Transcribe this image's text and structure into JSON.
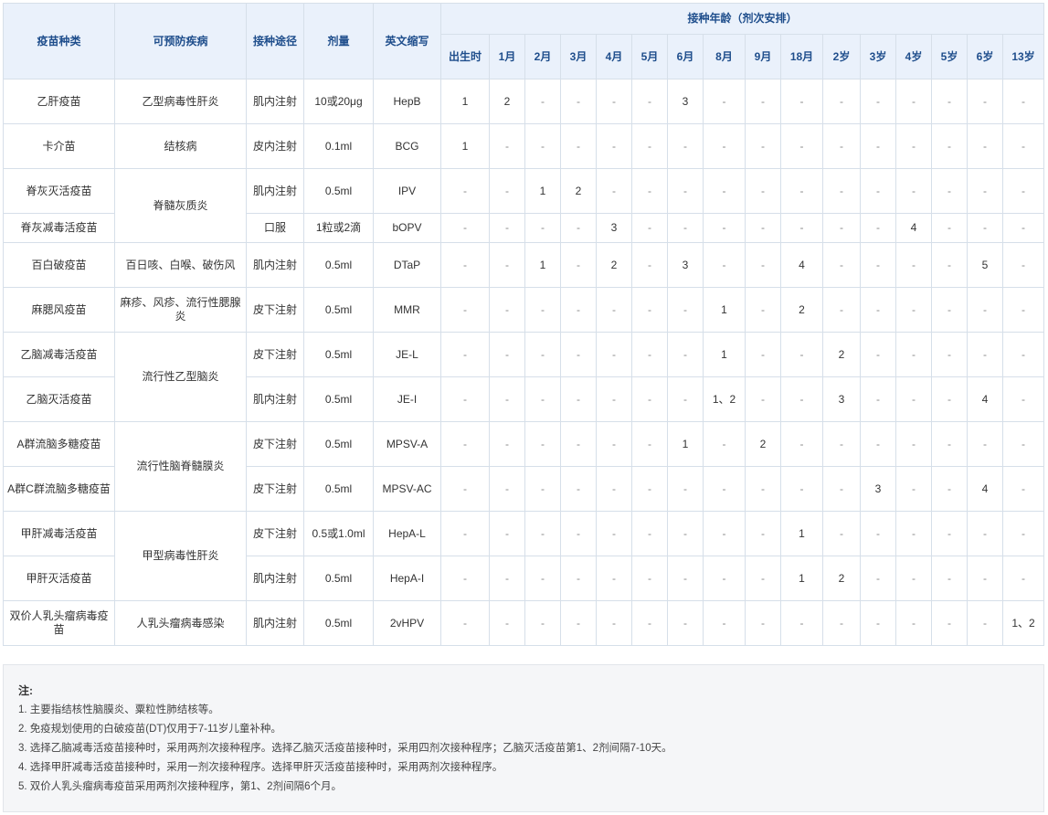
{
  "header": {
    "vaccine": "疫苗种类",
    "disease": "可预防疾病",
    "route": "接种途径",
    "dose": "剂量",
    "abbr": "英文缩写",
    "age_group": "接种年龄（剂次安排）",
    "ages": [
      "出生时",
      "1月",
      "2月",
      "3月",
      "4月",
      "5月",
      "6月",
      "8月",
      "9月",
      "18月",
      "2岁",
      "3岁",
      "4岁",
      "5岁",
      "6岁",
      "13岁"
    ]
  },
  "rows": [
    {
      "vaccine": "乙肝疫苗",
      "disease": "乙型病毒性肝炎",
      "route": "肌内注射",
      "dose": "10或20μg",
      "abbr": "HepB",
      "schedule": [
        "1",
        "2",
        "-",
        "-",
        "-",
        "-",
        "3",
        "-",
        "-",
        "-",
        "-",
        "-",
        "-",
        "-",
        "-",
        "-"
      ]
    },
    {
      "vaccine": "卡介苗",
      "disease": "结核病",
      "route": "皮内注射",
      "dose": "0.1ml",
      "abbr": "BCG",
      "schedule": [
        "1",
        "-",
        "-",
        "-",
        "-",
        "-",
        "-",
        "-",
        "-",
        "-",
        "-",
        "-",
        "-",
        "-",
        "-",
        "-"
      ]
    },
    {
      "vaccine": "脊灰灭活疫苗",
      "disease": "脊髓灰质炎",
      "route": "肌内注射",
      "dose": "0.5ml",
      "abbr": "IPV",
      "schedule": [
        "-",
        "-",
        "1",
        "2",
        "-",
        "-",
        "-",
        "-",
        "-",
        "-",
        "-",
        "-",
        "-",
        "-",
        "-",
        "-"
      ]
    },
    {
      "vaccine": "脊灰减毒活疫苗",
      "disease": "",
      "route": "口服",
      "dose": "1粒或2滴",
      "abbr": "bOPV",
      "schedule": [
        "-",
        "-",
        "-",
        "-",
        "3",
        "-",
        "-",
        "-",
        "-",
        "-",
        "-",
        "-",
        "4",
        "-",
        "-",
        "-"
      ]
    },
    {
      "vaccine": "百白破疫苗",
      "disease": "百日咳、白喉、破伤风",
      "route": "肌内注射",
      "dose": "0.5ml",
      "abbr": "DTaP",
      "schedule": [
        "-",
        "-",
        "1",
        "-",
        "2",
        "-",
        "3",
        "-",
        "-",
        "4",
        "-",
        "-",
        "-",
        "-",
        "5",
        "-"
      ]
    },
    {
      "vaccine": "麻腮风疫苗",
      "disease": "麻疹、风疹、流行性腮腺炎",
      "route": "皮下注射",
      "dose": "0.5ml",
      "abbr": "MMR",
      "schedule": [
        "-",
        "-",
        "-",
        "-",
        "-",
        "-",
        "-",
        "1",
        "-",
        "2",
        "-",
        "-",
        "-",
        "-",
        "-",
        "-"
      ]
    },
    {
      "vaccine": "乙脑减毒活疫苗",
      "disease": "流行性乙型脑炎",
      "route": "皮下注射",
      "dose": "0.5ml",
      "abbr": "JE-L",
      "schedule": [
        "-",
        "-",
        "-",
        "-",
        "-",
        "-",
        "-",
        "1",
        "-",
        "-",
        "2",
        "-",
        "-",
        "-",
        "-",
        "-"
      ]
    },
    {
      "vaccine": "乙脑灭活疫苗",
      "disease": "",
      "route": "肌内注射",
      "dose": "0.5ml",
      "abbr": "JE-I",
      "schedule": [
        "-",
        "-",
        "-",
        "-",
        "-",
        "-",
        "-",
        "1、2",
        "-",
        "-",
        "3",
        "-",
        "-",
        "-",
        "4",
        "-"
      ]
    },
    {
      "vaccine": "A群流脑多糖疫苗",
      "disease": "流行性脑脊髓膜炎",
      "route": "皮下注射",
      "dose": "0.5ml",
      "abbr": "MPSV-A",
      "schedule": [
        "-",
        "-",
        "-",
        "-",
        "-",
        "-",
        "1",
        "-",
        "2",
        "-",
        "-",
        "-",
        "-",
        "-",
        "-",
        "-"
      ]
    },
    {
      "vaccine": "A群C群流脑多糖疫苗",
      "disease": "",
      "route": "皮下注射",
      "dose": "0.5ml",
      "abbr": "MPSV-AC",
      "schedule": [
        "-",
        "-",
        "-",
        "-",
        "-",
        "-",
        "-",
        "-",
        "-",
        "-",
        "-",
        "3",
        "-",
        "-",
        "4",
        "-"
      ]
    },
    {
      "vaccine": "甲肝减毒活疫苗",
      "disease": "甲型病毒性肝炎",
      "route": "皮下注射",
      "dose": "0.5或1.0ml",
      "abbr": "HepA-L",
      "schedule": [
        "-",
        "-",
        "-",
        "-",
        "-",
        "-",
        "-",
        "-",
        "-",
        "1",
        "-",
        "-",
        "-",
        "-",
        "-",
        "-"
      ]
    },
    {
      "vaccine": "甲肝灭活疫苗",
      "disease": "",
      "route": "肌内注射",
      "dose": "0.5ml",
      "abbr": "HepA-I",
      "schedule": [
        "-",
        "-",
        "-",
        "-",
        "-",
        "-",
        "-",
        "-",
        "-",
        "1",
        "2",
        "-",
        "-",
        "-",
        "-",
        "-"
      ]
    },
    {
      "vaccine": "双价人乳头瘤病毒疫苗",
      "disease": "人乳头瘤病毒感染",
      "route": "肌内注射",
      "dose": "0.5ml",
      "abbr": "2vHPV",
      "schedule": [
        "-",
        "-",
        "-",
        "-",
        "-",
        "-",
        "-",
        "-",
        "-",
        "-",
        "-",
        "-",
        "-",
        "-",
        "-",
        "1、2"
      ]
    }
  ],
  "notes": {
    "title": "注:",
    "lines": [
      "1. 主要指结核性脑膜炎、粟粒性肺结核等。",
      "2. 免疫规划使用的白破疫苗(DT)仅用于7-11岁儿童补种。",
      "3. 选择乙脑减毒活疫苗接种时，采用两剂次接种程序。选择乙脑灭活疫苗接种时，采用四剂次接种程序；乙脑灭活疫苗第1、2剂间隔7-10天。",
      "4. 选择甲肝减毒活疫苗接种时，采用一剂次接种程序。选择甲肝灭活疫苗接种时，采用两剂次接种程序。",
      "5. 双价人乳头瘤病毒疫苗采用两剂次接种程序，第1、2剂间隔6个月。"
    ]
  }
}
